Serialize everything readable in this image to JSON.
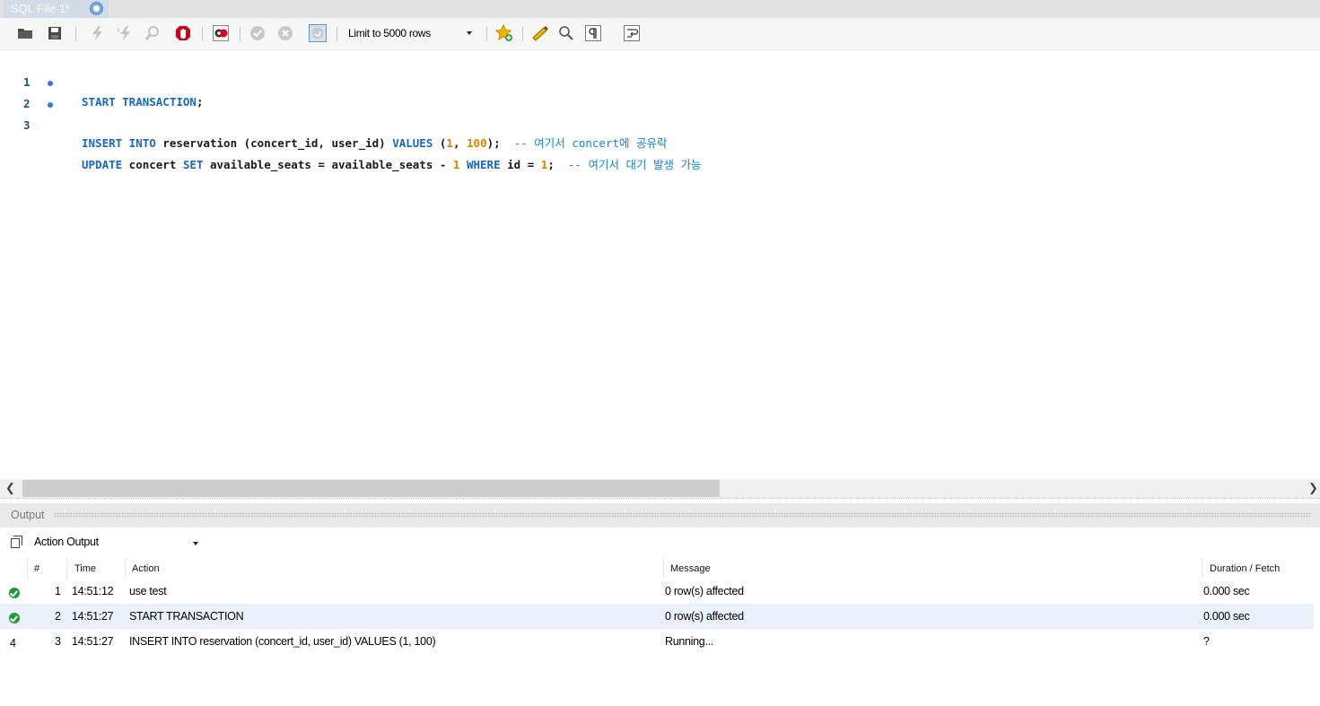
{
  "tab": {
    "title": "SQL File 1*",
    "close_icon": "close-tab-icon"
  },
  "toolbar": {
    "icons": [
      "open-folder-icon",
      "save-icon",
      "execute-icon",
      "execute-current-icon",
      "explain-icon",
      "stop-icon",
      "toggle-error-icon",
      "commit-icon",
      "rollback-icon",
      "autocommit-icon",
      "add-snippet-icon",
      "beautify-icon",
      "find-icon",
      "invisibles-icon",
      "wrap-icon"
    ],
    "limit_select": "Limit to 5000 rows"
  },
  "editor": {
    "lines": [
      {
        "number": "1",
        "marker": false
      },
      {
        "number": "2",
        "marker": true
      },
      {
        "number": "3",
        "marker": true
      }
    ],
    "code": {
      "l1": {
        "kw1": "START TRANSACTION",
        "p1": ";"
      },
      "l2": {
        "kw1": "INSERT INTO",
        "p1": " reservation (concert_id, user_id) ",
        "kw2": "VALUES",
        "p2": " (",
        "n1": "1",
        "p3": ", ",
        "n2": "100",
        "p4": ");  ",
        "comment": "-- 여기서 concert에 공유락"
      },
      "l3": {
        "kw1": "UPDATE",
        "p1": " concert ",
        "kw2": "SET",
        "p2": " available_seats = available_seats - ",
        "n1": "1",
        "p3": " ",
        "kw3": "WHERE",
        "p4": " id = ",
        "n2": "1",
        "p5": ";  ",
        "comment": "-- 여기서 대기 발생 가능"
      }
    },
    "colors": {
      "keyword": "#1668c4",
      "number": "#d98200",
      "comment": "#1680e0"
    }
  },
  "output": {
    "title": "Output",
    "selector": "Action Output",
    "columns": {
      "num": "#",
      "time": "Time",
      "action": "Action",
      "message": "Message",
      "duration": "Duration / Fetch"
    },
    "rows": [
      {
        "status": "ok",
        "num": "1",
        "time": "14:51:12",
        "action": "use test",
        "message": "0 row(s) affected",
        "duration": "0.000 sec"
      },
      {
        "status": "ok",
        "num": "2",
        "time": "14:51:27",
        "action": "START TRANSACTION",
        "message": "0 row(s) affected",
        "duration": "0.000 sec"
      },
      {
        "status": "running",
        "status_glyph": "4",
        "num": "3",
        "time": "14:51:27",
        "action": "INSERT INTO reservation (concert_id, user_id) VALUES (1, 100)",
        "message": "Running...",
        "duration": "?"
      }
    ]
  }
}
